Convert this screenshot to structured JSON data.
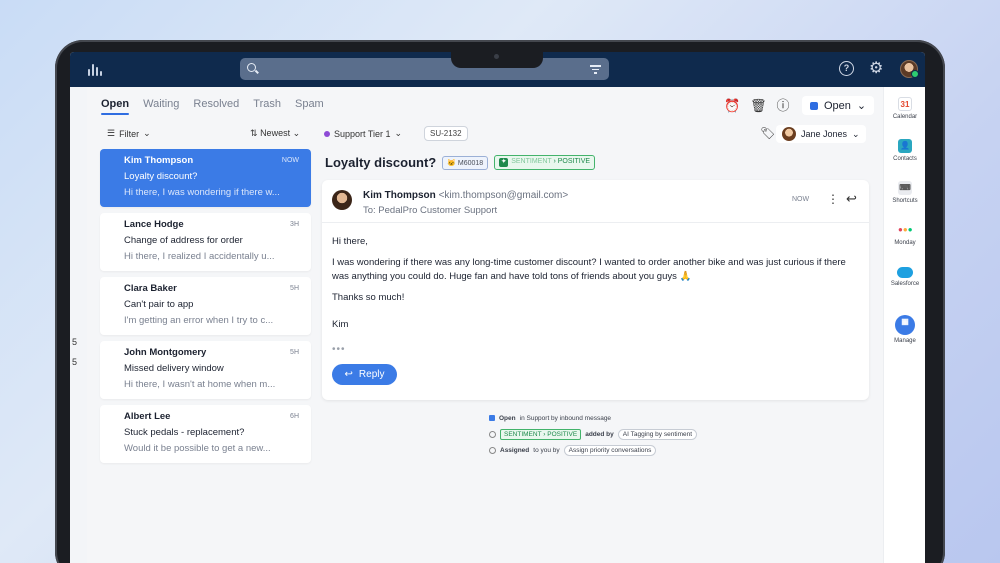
{
  "tabs": [
    "Open",
    "Waiting",
    "Resolved",
    "Trash",
    "Spam"
  ],
  "active_tab": "Open",
  "status_dropdown": "Open",
  "filter_label": "Filter",
  "sort_label": "Newest",
  "inbox_label": "Support Tier 1",
  "ticket_id": "SU-2132",
  "assignee_name": "Jane Jones",
  "left_strip": [
    "5",
    "5"
  ],
  "conversations": [
    {
      "name": "Kim Thompson",
      "time": "NOW",
      "subject": "Loyalty discount?",
      "preview": "Hi there, I was wondering if there w..."
    },
    {
      "name": "Lance Hodge",
      "time": "3H",
      "subject": "Change of address for order",
      "preview": "Hi there, I realized I accidentally u..."
    },
    {
      "name": "Clara Baker",
      "time": "5H",
      "subject": "Can't pair to app",
      "preview": "I'm getting an error when I try to c..."
    },
    {
      "name": "John Montgomery",
      "time": "5H",
      "subject": "Missed delivery window",
      "preview": "Hi there, I wasn't at home when m..."
    },
    {
      "name": "Albert Lee",
      "time": "6H",
      "subject": "Stuck pedals - replacement?",
      "preview": "Would it be possible to get a new..."
    }
  ],
  "detail": {
    "subject": "Loyalty discount?",
    "customer_chip": "M60018",
    "sentiment_label": "SENTIMENT",
    "sentiment_value": "POSITIVE",
    "from_name": "Kim Thompson",
    "from_email": "<kim.thompson@gmail.com>",
    "to": "To: PedalPro Customer Support",
    "time": "NOW",
    "body": [
      "Hi there,",
      "I was wondering if there was any long-time customer discount? I wanted to order another bike and was just curious if there was anything you could do. Huge fan and have told tons of friends about you guys 🙏",
      "Thanks so much!",
      "Kim"
    ],
    "reply_label": "Reply"
  },
  "activity": {
    "line1_bold": "Open",
    "line1_rest": "in Support by inbound message",
    "line2_mid": "added by",
    "line2_pill": "AI Tagging by sentiment",
    "line3_bold": "Assigned",
    "line3_rest": "to you by",
    "line3_pill": "Assign priority conversations"
  },
  "rail_apps": [
    "Calendar",
    "Contacts",
    "Shortcuts",
    "Monday",
    "Salesforce",
    "Manage"
  ],
  "calendar_day": "31",
  "colors": {
    "accent": "#3b7be6",
    "topbar": "#0f2a4d",
    "positive": "#1f8a4c"
  }
}
